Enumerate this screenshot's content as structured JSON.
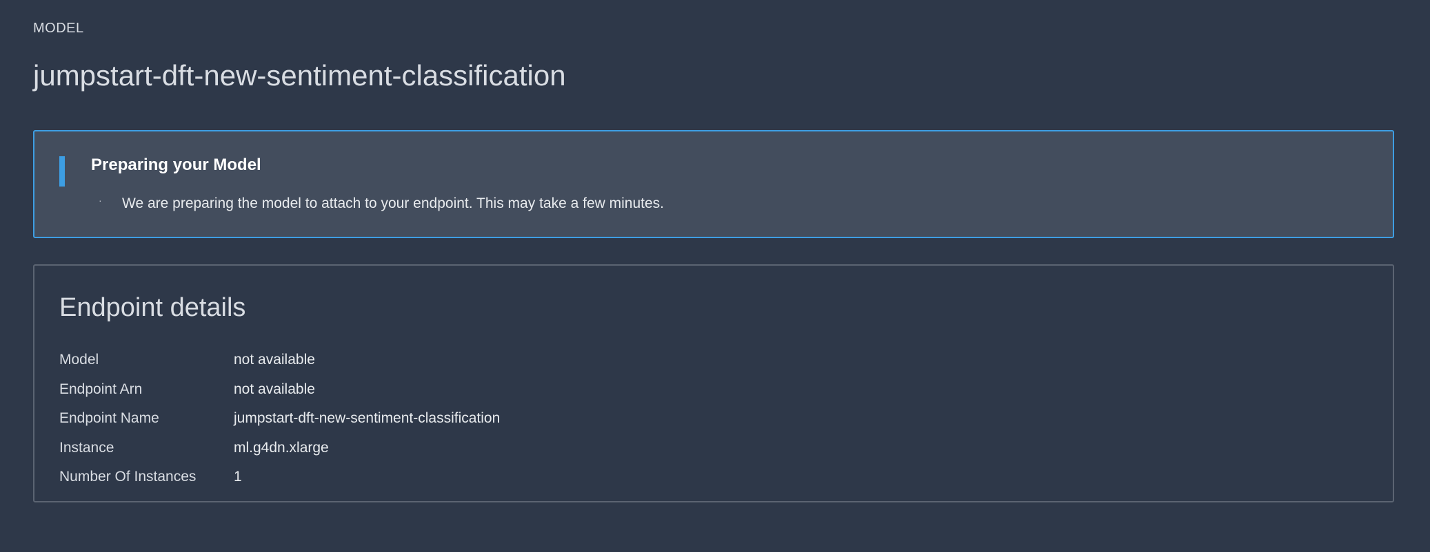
{
  "header": {
    "eyebrow": "MODEL",
    "title": "jumpstart-dft-new-sentiment-classification"
  },
  "banner": {
    "title": "Preparing your Model",
    "spinner": "·",
    "message": "We are preparing the model to attach to your endpoint. This may take a few minutes.",
    "accent_color": "#3d9ee3"
  },
  "details": {
    "title": "Endpoint details",
    "rows": [
      {
        "label": "Model",
        "value": "not available"
      },
      {
        "label": "Endpoint Arn",
        "value": "not available"
      },
      {
        "label": "Endpoint Name",
        "value": "jumpstart-dft-new-sentiment-classification"
      },
      {
        "label": "Instance",
        "value": "ml.g4dn.xlarge"
      },
      {
        "label": "Number Of Instances",
        "value": "1"
      }
    ]
  }
}
